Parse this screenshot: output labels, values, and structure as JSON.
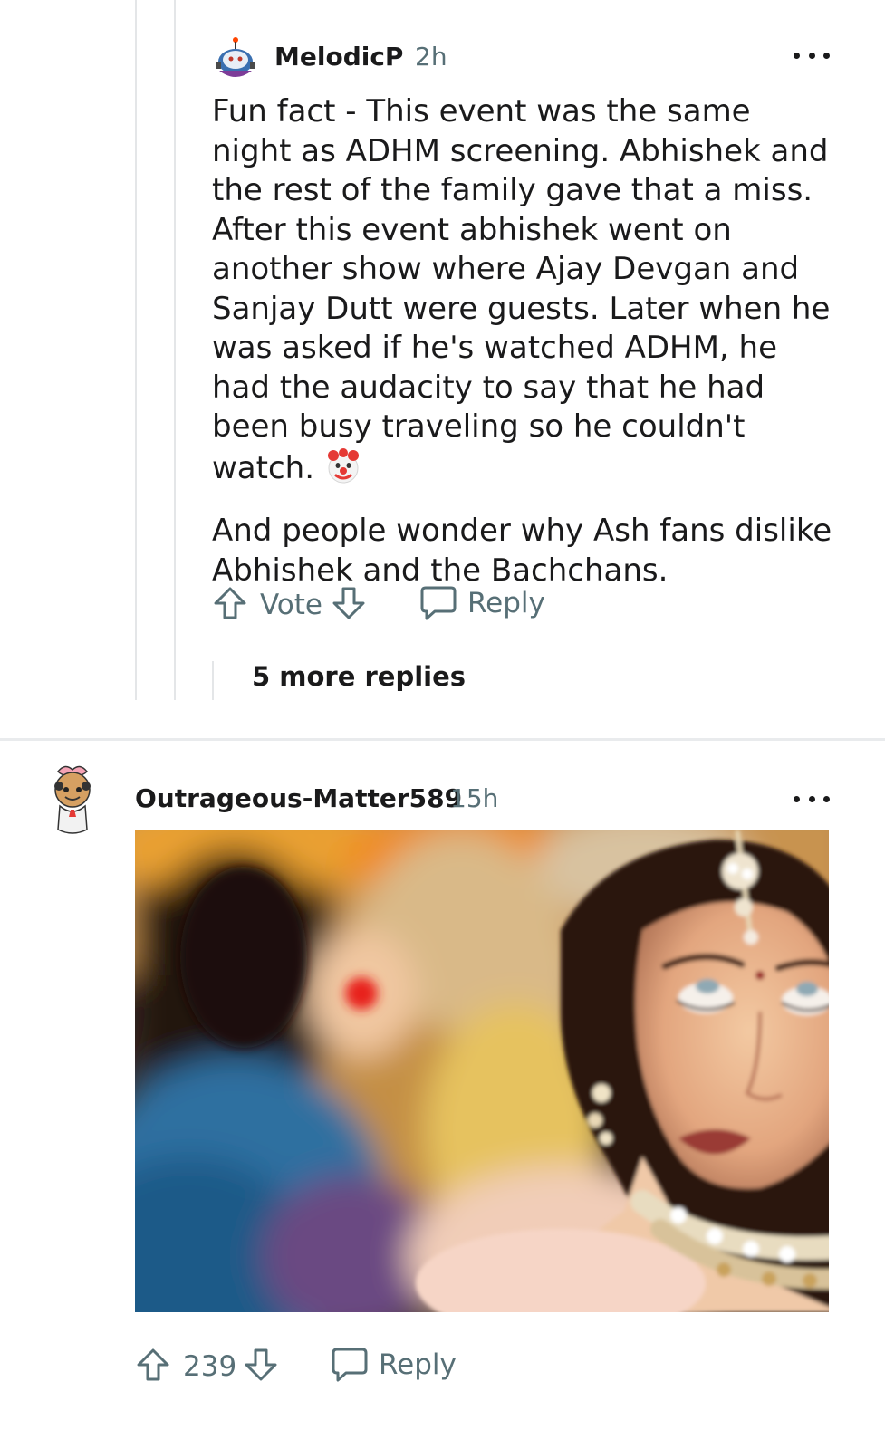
{
  "comment_reply": {
    "author": "MelodicP",
    "age": "2h",
    "avatar_icon": "snoo-avatar-icon",
    "paragraphs": [
      "Fun fact - This event was the same night as ADHM screening. Abhishek and the rest of the family gave that a miss. After this event abhishek went on another show where Ajay Devgan and Sanjay Dutt were guests. Later when he was asked if he's watched ADHM, he had the audacity to say that he had been busy traveling so he couldn't watch.",
      "And people wonder why Ash fans dislike Abhishek and the Bachchans."
    ],
    "emoji": "clown-face",
    "vote_label": "Vote",
    "reply_label": "Reply",
    "more_replies_label": "5 more replies"
  },
  "comment_top": {
    "author": "Outrageous-Matter589",
    "age": "15h",
    "avatar_icon": "snoo-avatar-icon",
    "media_icon": "gif-image-icon",
    "vote_count": "239",
    "reply_label": "Reply"
  },
  "colors": {
    "text": "#1a1a1b",
    "meta": "#576f76",
    "divider": "#e9ebed"
  }
}
